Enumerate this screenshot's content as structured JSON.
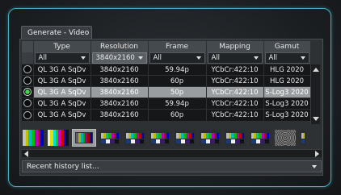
{
  "tab": {
    "label": "Generate - Video"
  },
  "table": {
    "columns": [
      "Type",
      "Resolution",
      "Frame",
      "Mapping",
      "Gamut"
    ],
    "filters": [
      "All",
      "3840x2160",
      "All",
      "All",
      "All"
    ],
    "rows": [
      {
        "type": "QL 3G A SqDv",
        "resolution": "3840x2160",
        "frame": "59.94p",
        "mapping": "YCbCr:422:10",
        "gamut": "HLG 2020",
        "selected": false
      },
      {
        "type": "QL 3G A SqDv",
        "resolution": "3840x2160",
        "frame": "60p",
        "mapping": "YCbCr:422:10",
        "gamut": "HLG 2020",
        "selected": false
      },
      {
        "type": "QL 3G A SqDv",
        "resolution": "3840x2160",
        "frame": "50p",
        "mapping": "YCbCr:422:10",
        "gamut": "S-Log3 2020",
        "selected": true
      },
      {
        "type": "QL 3G A SqDv",
        "resolution": "3840x2160",
        "frame": "59.94p",
        "mapping": "YCbCr:422:10",
        "gamut": "S-Log3 2020",
        "selected": false
      },
      {
        "type": "QL 3G A SqDv",
        "resolution": "3840x2160",
        "frame": "60p",
        "mapping": "YCbCr:422:10",
        "gamut": "S-Log3 2020",
        "selected": false
      }
    ]
  },
  "thumbnails": [
    {
      "name": "colour-bars-100",
      "selected": false
    },
    {
      "name": "colour-bars-75",
      "selected": false
    },
    {
      "name": "colour-bars-split",
      "selected": true
    },
    {
      "name": "smpte-bars-1",
      "selected": false
    },
    {
      "name": "smpte-bars-2",
      "selected": false
    },
    {
      "name": "smpte-bars-3",
      "selected": false
    },
    {
      "name": "smpte-bars-4",
      "selected": false
    },
    {
      "name": "smpte-bars-5",
      "selected": false
    },
    {
      "name": "smpte-bars-6",
      "selected": false
    },
    {
      "name": "smpte-bars-7",
      "selected": false
    },
    {
      "name": "zone-plate",
      "selected": false
    },
    {
      "name": "smpte-bars-8",
      "selected": false
    }
  ],
  "history": {
    "label": "Recent history list..."
  },
  "colors": {
    "accent": "#3fb3c2",
    "selected_row": "#9a9da0",
    "radio_on": "#41d84a"
  }
}
